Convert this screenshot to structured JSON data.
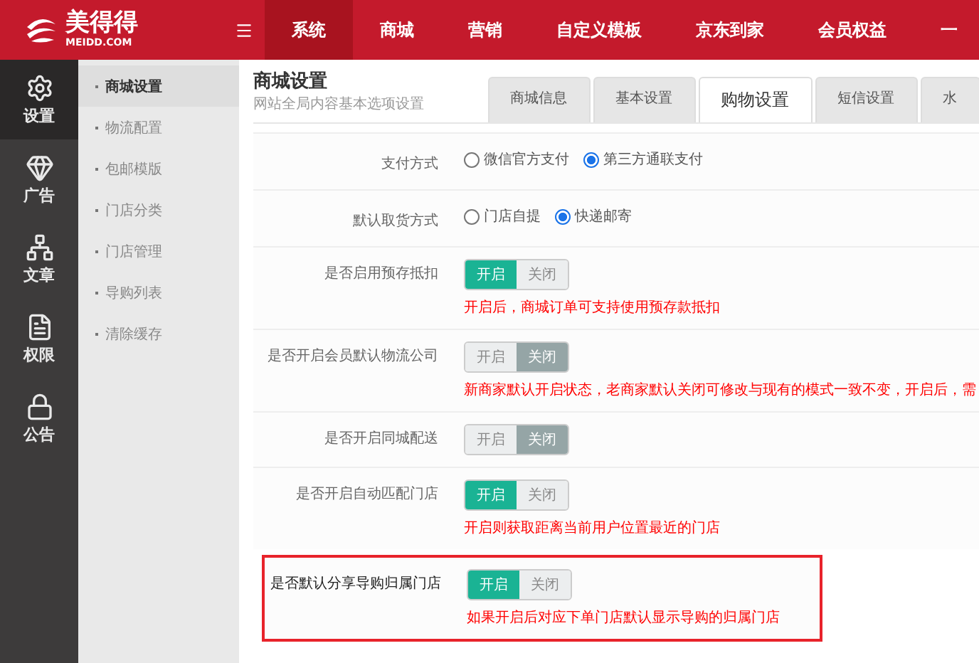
{
  "logo": {
    "name": "美得得",
    "domain": "MEIDD.COM"
  },
  "top_nav": [
    {
      "label": "系统",
      "selected": true
    },
    {
      "label": "商城",
      "selected": false
    },
    {
      "label": "营销",
      "selected": false
    },
    {
      "label": "自定义模板",
      "selected": false
    },
    {
      "label": "京东到家",
      "selected": false
    },
    {
      "label": "会员权益",
      "selected": false
    },
    {
      "label": "一",
      "selected": false
    }
  ],
  "sidebar": {
    "items": [
      {
        "label": "设置",
        "kind": "gear",
        "selected": true
      },
      {
        "label": "广告",
        "kind": "gem",
        "selected": false
      },
      {
        "label": "文章",
        "kind": "network",
        "selected": false
      },
      {
        "label": "权限",
        "kind": "file",
        "selected": false
      },
      {
        "label": "公告",
        "kind": "lock",
        "selected": false
      }
    ]
  },
  "submenu": {
    "items": [
      {
        "label": "商城设置",
        "selected": true
      },
      {
        "label": "物流配置",
        "selected": false
      },
      {
        "label": "包邮模版",
        "selected": false
      },
      {
        "label": "门店分类",
        "selected": false
      },
      {
        "label": "门店管理",
        "selected": false
      },
      {
        "label": "导购列表",
        "selected": false
      },
      {
        "label": "清除缓存",
        "selected": false
      }
    ]
  },
  "page": {
    "title": "商城设置",
    "subtitle": "网站全局内容基本选项设置"
  },
  "tabs": [
    {
      "label": "商城信息",
      "selected": false
    },
    {
      "label": "基本设置",
      "selected": false
    },
    {
      "label": "购物设置",
      "selected": true
    },
    {
      "label": "短信设置",
      "selected": false
    },
    {
      "label": "水",
      "selected": false
    }
  ],
  "settings": [
    {
      "kind": "radio",
      "label": "支付方式",
      "options": [
        {
          "label": "微信官方支付",
          "selected": false
        },
        {
          "label": "第三方通联支付",
          "selected": true
        }
      ],
      "highlighted": false
    },
    {
      "kind": "radio",
      "label": "默认取货方式",
      "options": [
        {
          "label": "门店自提",
          "selected": false
        },
        {
          "label": "快递邮寄",
          "selected": true
        }
      ],
      "highlighted": false
    },
    {
      "kind": "toggle",
      "label": "是否启用预存抵扣",
      "on_label": "开启",
      "off_label": "关闭",
      "on": true,
      "note": "开启后，商城订单可支持使用预存款抵扣",
      "highlighted": false
    },
    {
      "kind": "toggle",
      "label": "是否开启会员默认物流公司",
      "on_label": "开启",
      "off_label": "关闭",
      "on": false,
      "note": "新商家默认开启状态，老商家默认关闭可修改与现有的模式一致不变，开启后，需",
      "highlighted": false
    },
    {
      "kind": "toggle",
      "label": "是否开启同城配送",
      "on_label": "开启",
      "off_label": "关闭",
      "on": false,
      "highlighted": false
    },
    {
      "kind": "toggle",
      "label": "是否开启自动匹配门店",
      "on_label": "开启",
      "off_label": "关闭",
      "on": true,
      "note": "开启则获取距离当前用户位置最近的门店",
      "highlighted": false
    },
    {
      "kind": "toggle",
      "label": "是否默认分享导购归属门店",
      "on_label": "开启",
      "off_label": "关闭",
      "on": true,
      "note": "如果开启后对应下单门店默认显示导购的归属门店",
      "highlighted": true
    }
  ]
}
